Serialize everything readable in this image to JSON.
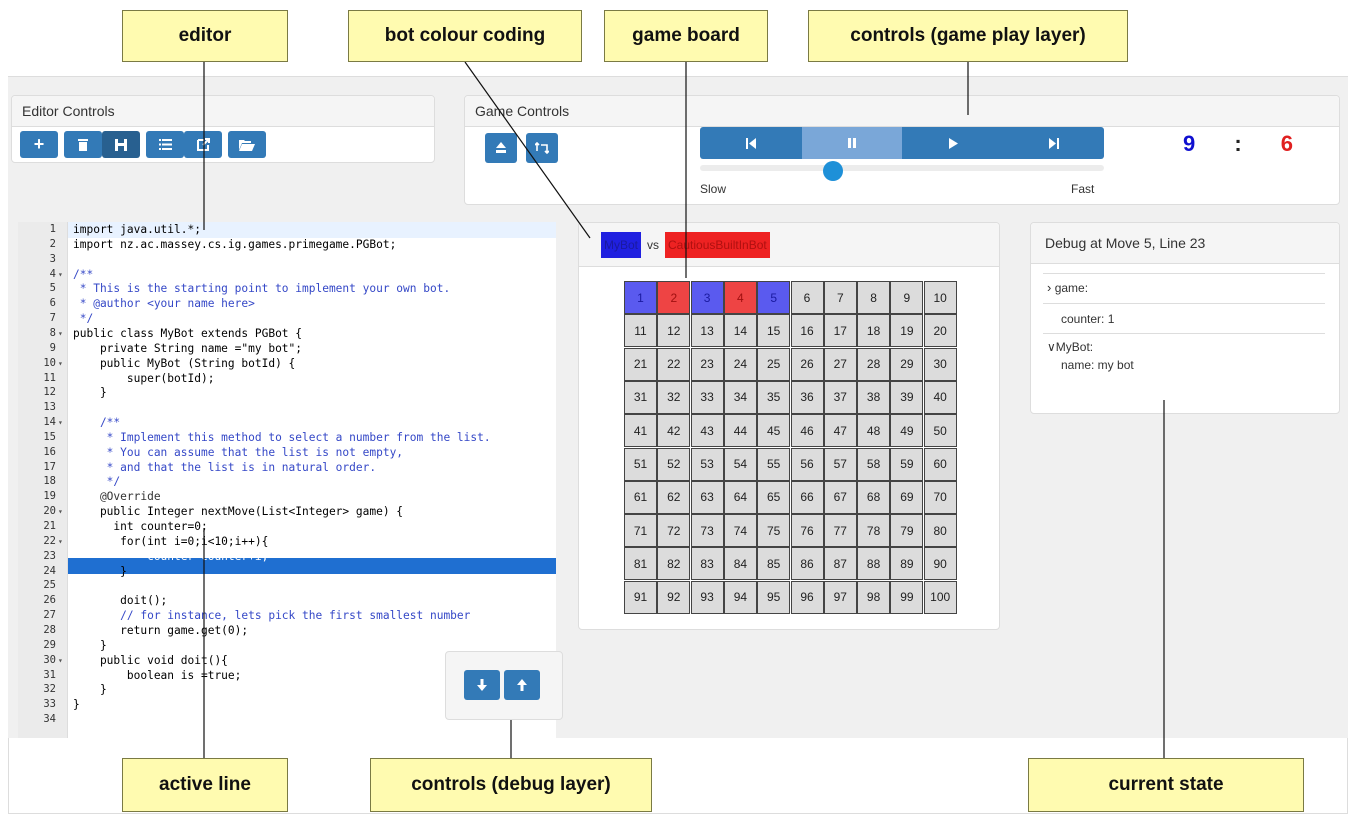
{
  "callouts": {
    "editor": "editor",
    "bot_colour_coding": "bot colour coding",
    "game_board": "game board",
    "controls_game_play": "controls (game play layer)",
    "active_line": "active line",
    "controls_debug": "controls (debug layer)",
    "current_state": "current state"
  },
  "editor_controls": {
    "title": "Editor Controls",
    "buttons": [
      "new-file",
      "delete",
      "save",
      "list",
      "export",
      "open-folder"
    ]
  },
  "game_controls": {
    "title": "Game Controls",
    "slider_min_label": "Slow",
    "slider_max_label": "Fast",
    "speed_level": 0.33,
    "score_blue": "9",
    "score_sep": ":",
    "score_red": "6",
    "colors": {
      "blue": "#1010d0",
      "red": "#e02020",
      "button": "#337ab7"
    }
  },
  "matchup": {
    "bot1": "MyBot",
    "vs": "vs",
    "bot2": "CautiousBuiltInBot",
    "bot1_color": "#2020e0",
    "bot2_color": "#ee2222"
  },
  "board": {
    "numbers": [
      1,
      2,
      3,
      4,
      5,
      6,
      7,
      8,
      9,
      10,
      11,
      12,
      13,
      14,
      15,
      16,
      17,
      18,
      19,
      20,
      21,
      22,
      23,
      24,
      25,
      26,
      27,
      28,
      29,
      30,
      31,
      32,
      33,
      34,
      35,
      36,
      37,
      38,
      39,
      40,
      41,
      42,
      43,
      44,
      45,
      46,
      47,
      48,
      49,
      50,
      51,
      52,
      53,
      54,
      55,
      56,
      57,
      58,
      59,
      60,
      61,
      62,
      63,
      64,
      65,
      66,
      67,
      68,
      69,
      70,
      71,
      72,
      73,
      74,
      75,
      76,
      77,
      78,
      79,
      80,
      81,
      82,
      83,
      84,
      85,
      86,
      87,
      88,
      89,
      90,
      91,
      92,
      93,
      94,
      95,
      96,
      97,
      98,
      99,
      100
    ],
    "taken": {
      "1": "blue",
      "2": "red",
      "3": "blue",
      "4": "red",
      "5": "blue"
    }
  },
  "debug": {
    "title": "Debug at Move 5, Line 23",
    "game_label": "game:",
    "counter_text": "counter: 1",
    "mybot_label": "MyBot:",
    "name_text": "name: my bot"
  },
  "code": {
    "active_line": 23,
    "lines": [
      "import java.util.*;",
      "import nz.ac.massey.cs.ig.games.primegame.PGBot;",
      "",
      "/**",
      " * This is the starting point to implement your own bot.",
      " * @author <your name here>",
      " */",
      "public class MyBot extends PGBot {",
      "    private String name =\"my bot\";",
      "    public MyBot (String botId) {",
      "        super(botId);",
      "    }",
      "",
      "    /**",
      "     * Implement this method to select a number from the list.",
      "     * You can assume that the list is not empty,",
      "     * and that the list is in natural order.",
      "     */",
      "    @Override",
      "    public Integer nextMove(List<Integer> game) {",
      "      int counter=0;",
      "       for(int i=0;i<10;i++){",
      "           counter=counter+i;",
      "       }",
      "",
      "       doit();",
      "       // for instance, lets pick the first smallest number",
      "       return game.get(0);",
      "    }",
      "    public void doit(){",
      "        boolean is =true;",
      "    }",
      "}",
      ""
    ],
    "folds": [
      4,
      8,
      10,
      14,
      20,
      22,
      30
    ]
  }
}
